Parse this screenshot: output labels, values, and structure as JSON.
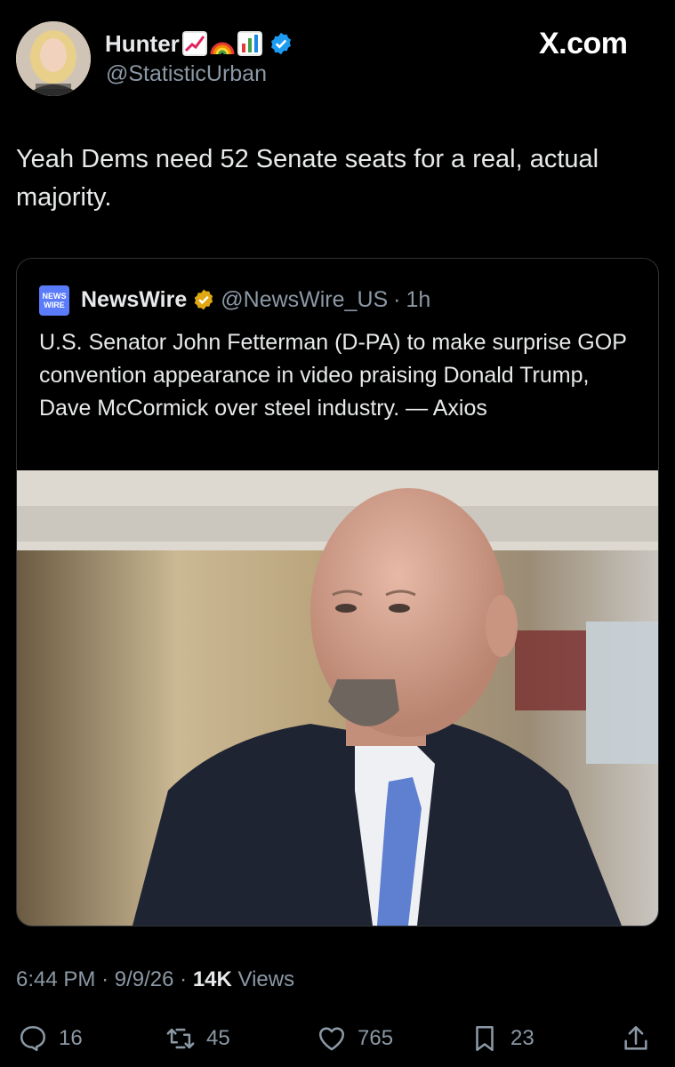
{
  "header": {
    "display_name": "Hunter",
    "handle": "@StatisticUrban",
    "emoji_icons": [
      "chart-increasing-icon",
      "rainbow-icon",
      "bar-chart-icon"
    ],
    "verified_color": "#1d9bf0",
    "watermark": "X.com"
  },
  "tweet": {
    "text": "Yeah Dems need 52 Senate seats for a real, actual majority."
  },
  "quote": {
    "logo_line1": "NEWS",
    "logo_line2": "WIRE",
    "name": "NewsWire",
    "handle": "@NewsWire_US",
    "separator": "·",
    "time": "1h",
    "verified_color": "#e0a813",
    "text": "U.S. Senator John Fetterman (D-PA) to make surprise GOP convention appearance in video praising Donald Trump, Dave McCormick over steel industry. — Axios",
    "photo_icon": "man-in-suit-photo"
  },
  "meta": {
    "time": "6:44 PM",
    "date": "9/9/26",
    "views_count": "14K",
    "views_label": "Views",
    "dot": "·"
  },
  "actions": {
    "replies": "16",
    "reposts": "45",
    "likes": "765",
    "bookmarks": "23"
  }
}
